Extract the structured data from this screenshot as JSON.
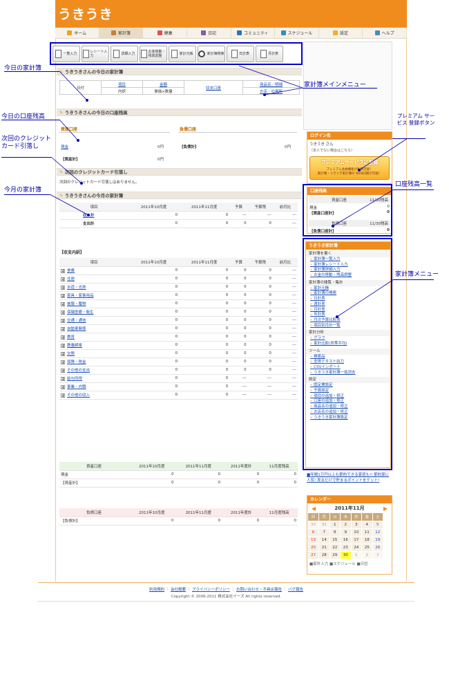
{
  "header": {
    "logo": "うきうき"
  },
  "nav": [
    {
      "label": "ホーム",
      "icon": "home-icon",
      "color": "#f0a020"
    },
    {
      "label": "家計簿",
      "icon": "pencil-icon",
      "color": "#c08040"
    },
    {
      "label": "健康",
      "icon": "heart-icon",
      "color": "#e05050"
    },
    {
      "label": "日記",
      "icon": "person-icon",
      "color": "#8060a0"
    },
    {
      "label": "コミュニティ",
      "icon": "people-icon",
      "color": "#3070c0"
    },
    {
      "label": "スケジュール",
      "icon": "calendar-icon",
      "color": "#3090c0"
    },
    {
      "label": "設定",
      "icon": "star-icon",
      "color": "#f0b020"
    },
    {
      "label": "ヘルプ",
      "icon": "help-icon",
      "color": "#4090c0"
    }
  ],
  "menu": [
    "一覧入力",
    "レシート入力",
    "詳細入力",
    "お金移動・残高調整",
    "家計元帳",
    "家計簿検索",
    "日計表",
    "月計表"
  ],
  "callouts": {
    "today_book": "今日の家計簿",
    "main_menu": "家計簿メインメニュー",
    "today_balance": "今日の口座残高",
    "next_credit": "次回のクレジットカード引落し",
    "premium": "プレミアム サービス 登録ボタン",
    "balance_list": "口座残高一覧",
    "month_book": "今月の家計簿",
    "book_menu": "家計簿メニュー"
  },
  "today": {
    "title": "うきうきさんの今日の家計簿",
    "col_date": "日付",
    "col_item": "項目",
    "col_detail": "内訳",
    "col_amount": "金額",
    "col_unit": "単価×数量",
    "col_payment": "収支口座",
    "col_product": "商品名／明細",
    "col_shop": "お店／の場所"
  },
  "balance": {
    "title": "うきうきさんの今日の口座残高",
    "asset_head": "資産口座",
    "debt_head": "負債口座",
    "cash": "現金",
    "cash_val": "0円",
    "asset_total": "【資産計】",
    "asset_total_val": "0円",
    "debt_total": "【負債計】",
    "debt_total_val": "0円"
  },
  "credit": {
    "title": "次回のクレジットカード引落し",
    "text": "次回のクレジットカード引落しはありません。"
  },
  "month": {
    "title": "うきうきさんの今月の家計簿",
    "cols": [
      "項目",
      "2011年10月度",
      "2011年11月度",
      "予算",
      "予算残",
      "前月比"
    ],
    "rows": [
      {
        "label": "収入計",
        "v": [
          "0",
          "0",
          "---",
          "---",
          "---"
        ]
      },
      {
        "label": "支出計",
        "v": [
          "0",
          "0",
          "0",
          "0",
          "---"
        ]
      }
    ]
  },
  "detail": {
    "title": "【収支内訳】",
    "cols": [
      "項目",
      "2011年10月度",
      "2011年11月度",
      "予算",
      "予算残",
      "前月比"
    ],
    "rows": [
      {
        "label": "食費",
        "v": [
          "0",
          "0",
          "0",
          "0",
          "---"
        ]
      },
      {
        "label": "住居",
        "v": [
          "0",
          "0",
          "0",
          "0",
          "---"
        ]
      },
      {
        "label": "水道・光熱",
        "v": [
          "0",
          "0",
          "0",
          "0",
          "---"
        ]
      },
      {
        "label": "家具・家事用品",
        "v": [
          "0",
          "0",
          "0",
          "0",
          "---"
        ]
      },
      {
        "label": "被服・履物",
        "v": [
          "0",
          "0",
          "0",
          "0",
          "---"
        ]
      },
      {
        "label": "保健医療・衛生",
        "v": [
          "0",
          "0",
          "0",
          "0",
          "---"
        ]
      },
      {
        "label": "交通・通信",
        "v": [
          "0",
          "0",
          "0",
          "0",
          "---"
        ]
      },
      {
        "label": "自動車関係",
        "v": [
          "0",
          "0",
          "0",
          "0",
          "---"
        ]
      },
      {
        "label": "教育",
        "v": [
          "0",
          "0",
          "0",
          "0",
          "---"
        ]
      },
      {
        "label": "教養娯楽",
        "v": [
          "0",
          "0",
          "0",
          "0",
          "---"
        ]
      },
      {
        "label": "交際",
        "v": [
          "0",
          "0",
          "0",
          "0",
          "---"
        ]
      },
      {
        "label": "保険・税金",
        "v": [
          "0",
          "0",
          "0",
          "0",
          "---"
        ]
      },
      {
        "label": "その他の支出",
        "v": [
          "0",
          "0",
          "0",
          "0",
          "---"
        ]
      },
      {
        "label": "給与所得",
        "v": [
          "0",
          "0",
          "---",
          "---",
          "---"
        ]
      },
      {
        "label": "事業・内職",
        "v": [
          "0",
          "0",
          "---",
          "---",
          "---"
        ]
      },
      {
        "label": "その他の収入",
        "v": [
          "0",
          "0",
          "---",
          "---",
          "---"
        ]
      }
    ]
  },
  "assets_table": {
    "cols": [
      "資産口座",
      "2011年10月度",
      "2011年11月度",
      "2011年度計",
      "11月度残高"
    ],
    "rows": [
      {
        "label": "現金",
        "v": [
          "0",
          "0",
          "0",
          "0"
        ]
      },
      {
        "label": "【資産計】",
        "v": [
          "0",
          "0",
          "0",
          "0"
        ]
      }
    ]
  },
  "debts_table": {
    "cols": [
      "負債口座",
      "2011年10月度",
      "2011年11月度",
      "2011年度計",
      "11月度残高"
    ],
    "rows": [
      {
        "label": "【負債計】",
        "v": [
          "0",
          "0",
          "0",
          "0"
        ]
      }
    ]
  },
  "sidebar": {
    "login_title": "ログイン名",
    "login_name": "うきうき さん",
    "login_note": "（本人でない場合はこちら）",
    "premium_banner": "プレミアムサービスに登録",
    "premium_sub1": "プレミアム会員機能が利用可能！",
    "premium_sub2": "家計簿・うきうき家計簿の WEB同期が可能！",
    "bal_title": "口座残高",
    "bal_asset_head": "資産口座",
    "bal_date": "11/30残高",
    "bal_cash": "現金",
    "bal_cash_val": "0",
    "bal_asset_total": "【資産口座計】",
    "bal_asset_total_val": "0",
    "bal_debt_head": "負債口座",
    "bal_debt_total": "【負債口座計】",
    "bal_debt_total_val": "0",
    "book_title": "うきうき家計簿",
    "groups": [
      {
        "name": "家計簿を書く",
        "items": [
          "家計簿一覧入力",
          "家計簿レシート入力",
          "家計簿詳細入力",
          "お金の移動・残高調整"
        ]
      },
      {
        "name": "家計簿の閲覧・集計",
        "items": [
          "家計元帳",
          "家計簿の検索",
          "日計表",
          "週計表",
          "月計表",
          "年計表",
          "月次予算比較表",
          "項目別月計一覧"
        ]
      },
      {
        "name": "家計分析",
        "items": [
          "グラフ",
          "家計比較(世帯平均)"
        ]
      },
      {
        "name": "ツール",
        "items": [
          "検索品",
          "全体テキスト出力",
          "CSVインポート",
          "うきうき家計簿一括消去"
        ]
      },
      {
        "name": "設定",
        "items": [
          "固定費設定",
          "予算設定",
          "項目の追加・修正",
          "口座の追加・修正",
          "商品名の追加・修正",
          "お店名の追加・修正",
          "うきうき家計簿設定"
        ]
      }
    ],
    "notice": "■年間1万円以上も節約できる家庭も!! 節約家に人気! 見るだけで貯まるポイントをゲット!",
    "cal_title": "カレンダー",
    "cal_month": "2011年11月",
    "cal_days": [
      "日",
      "月",
      "火",
      "水",
      "木",
      "金",
      "土"
    ],
    "cal_weeks": [
      [
        "30",
        "31",
        "1",
        "2",
        "3",
        "4",
        "5"
      ],
      [
        "6",
        "7",
        "8",
        "9",
        "10",
        "11",
        "12"
      ],
      [
        "13",
        "14",
        "15",
        "16",
        "17",
        "18",
        "19"
      ],
      [
        "20",
        "21",
        "22",
        "23",
        "24",
        "25",
        "26"
      ],
      [
        "27",
        "28",
        "29",
        "30",
        "1",
        "2",
        "3"
      ]
    ],
    "cal_today": "30",
    "legend": "■家計入力 ■スケジュール ■日記"
  },
  "footer": {
    "links": [
      "利用規約",
      "会社概要",
      "プライバシーポリシー",
      "お問い合わせ・不具合報告",
      "バグ報告"
    ],
    "copyright": "Copyright © 2006-2011 株式会社イーズ All rights reserved."
  }
}
